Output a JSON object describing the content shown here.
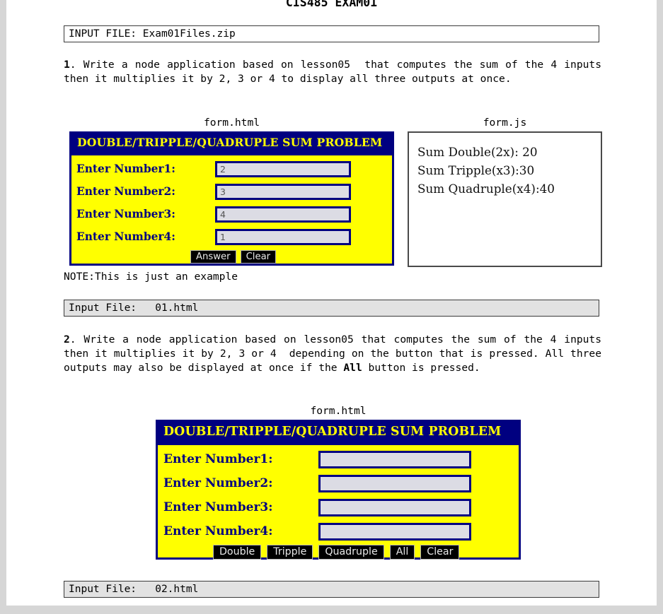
{
  "document": {
    "title": "CIS485 EXAM01"
  },
  "input_file_top": {
    "text": "INPUT FILE: Exam01Files.zip"
  },
  "question1": {
    "number": "1",
    "text": ". Write a node application based on lesson05  that computes the sum of the 4 inputs then it multiplies it by 2, 3 or 4 to display all three outputs at once.",
    "caption_form_html": "form.html",
    "caption_form_js": "form.js",
    "note": "NOTE:This is just an example",
    "input_file": "Input File:   01.html"
  },
  "question2": {
    "number": "2",
    "text_part1": ". Write a node application based on lesson05 that computes the sum of the 4 inputs then it multiplies it by 2, 3 or 4  depending on the button that is pressed. All three outputs may also be displayed at once if the ",
    "bold_word": "All",
    "text_part2": " button is pressed.",
    "caption_form_html": "form.html",
    "input_file": "Input File:   02.html"
  },
  "form1": {
    "header": "DOUBLE/TRIPPLE/QUADRUPLE SUM PROBLEM",
    "fields": [
      {
        "label": "Enter Number1:",
        "value": "2"
      },
      {
        "label": "Enter Number2:",
        "value": "3"
      },
      {
        "label": "Enter Number3:",
        "value": "4"
      },
      {
        "label": "Enter Number4:",
        "value": "1"
      }
    ],
    "buttons": [
      "Answer",
      "Clear"
    ]
  },
  "form2": {
    "header": "DOUBLE/TRIPPLE/QUADRUPLE SUM PROBLEM",
    "fields": [
      {
        "label": "Enter Number1:",
        "value": ""
      },
      {
        "label": "Enter Number2:",
        "value": ""
      },
      {
        "label": "Enter Number3:",
        "value": ""
      },
      {
        "label": "Enter Number4:",
        "value": ""
      }
    ],
    "buttons": [
      "Double",
      "Tripple",
      "Quadruple",
      "All",
      "Clear"
    ]
  },
  "output_panel": {
    "lines": [
      "Sum Double(2x): 20",
      "Sum Tripple(x3):30",
      "Sum Quadruple(x4):40"
    ]
  },
  "colors": {
    "navy": "#000080",
    "yellow": "#ffff00",
    "input_fill": "#dcdce4",
    "button_bg": "#000000",
    "filebar_gray": "#e2e2e2",
    "page_bg": "#ffffff",
    "canvas_bg": "#d6d6d6"
  }
}
